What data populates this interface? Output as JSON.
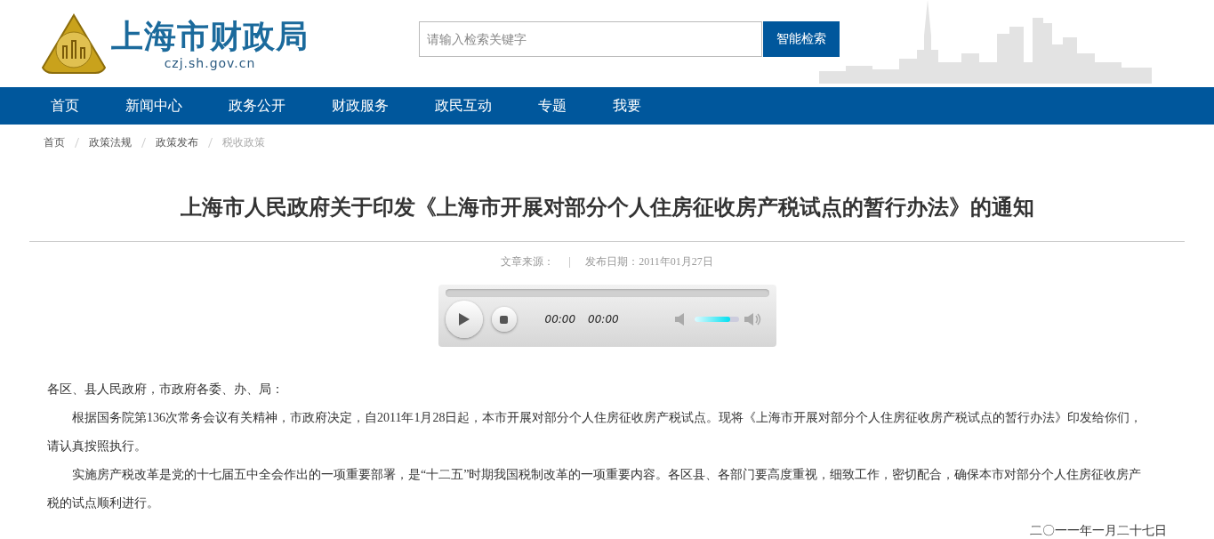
{
  "header": {
    "logo_title": "上海市财政局",
    "logo_url": "czj.sh.gov.cn",
    "search": {
      "placeholder": "请输入检索关键字",
      "button": "智能检索"
    }
  },
  "nav": [
    {
      "label": "首页"
    },
    {
      "label": "新闻中心"
    },
    {
      "label": "政务公开"
    },
    {
      "label": "财政服务"
    },
    {
      "label": "政民互动"
    },
    {
      "label": "专题"
    },
    {
      "label": "我要"
    }
  ],
  "breadcrumb": [
    {
      "label": "首页",
      "current": false
    },
    {
      "label": "政策法规",
      "current": false
    },
    {
      "label": "政策发布",
      "current": false
    },
    {
      "label": "税收政策",
      "current": true
    }
  ],
  "article": {
    "title": "上海市人民政府关于印发《上海市开展对部分个人住房征收房产税试点的暂行办法》的通知",
    "source_label": "文章来源：",
    "date": "发布日期：2011年01月27日",
    "player": {
      "progress": {
        "level": 0
      },
      "current_time": "00:00",
      "duration": "00:00",
      "volume": {
        "level": 0.8
      }
    },
    "paragraphs": [
      {
        "text": "各区、县人民政府，市政府各委、办、局：",
        "indent": false
      },
      {
        "text": "根据国务院第136次常务会议有关精神，市政府决定，自2011年1月28日起，本市开展对部分个人住房征收房产税试点。现将《上海市开展对部分个人住房征收房产税试点的暂行办法》印发给你们，请认真按照执行。",
        "indent": true
      },
      {
        "text": "实施房产税改革是党的十七届五中全会作出的一项重要部署，是“十二五”时期我国税制改革的一项重要内容。各区县、各部门要高度重视，细致工作，密切配合，确保本市对部分个人住房征收房产税的试点顺利进行。",
        "indent": true
      }
    ],
    "signature_date": "二〇一一年一月二十七日"
  }
}
